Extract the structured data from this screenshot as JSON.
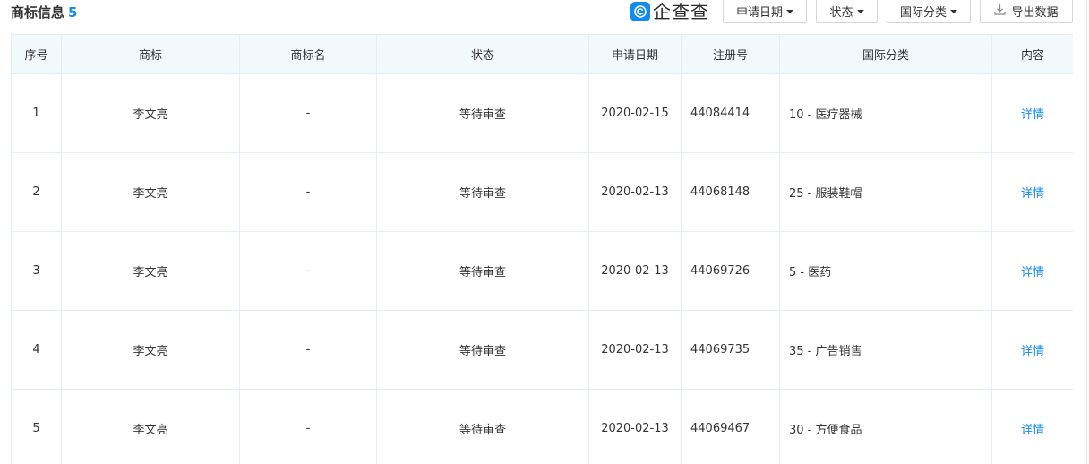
{
  "header": {
    "title": "商标信息",
    "count": "5",
    "brand_name": "企查查",
    "brand_icon": "qichacha-logo-icon",
    "filters": [
      {
        "label": "申请日期"
      },
      {
        "label": "状态"
      },
      {
        "label": "国际分类"
      }
    ],
    "export_label": "导出数据",
    "export_icon": "download-icon"
  },
  "colors": {
    "accent": "#128bed",
    "header_bg": "#f2f9fc",
    "border": "#e4eef6"
  },
  "table": {
    "columns": [
      "序号",
      "商标",
      "商标名",
      "状态",
      "申请日期",
      "注册号",
      "国际分类",
      "内容"
    ],
    "rows": [
      {
        "index": "1",
        "mark": "李文亮",
        "name": "-",
        "status": "等待审查",
        "date": "2020-02-15",
        "reg_no": "44084414",
        "class": "10 - 医疗器械",
        "action": "详情"
      },
      {
        "index": "2",
        "mark": "李文亮",
        "name": "-",
        "status": "等待审查",
        "date": "2020-02-13",
        "reg_no": "44068148",
        "class": "25 - 服装鞋帽",
        "action": "详情"
      },
      {
        "index": "3",
        "mark": "李文亮",
        "name": "-",
        "status": "等待审查",
        "date": "2020-02-13",
        "reg_no": "44069726",
        "class": "5 - 医药",
        "action": "详情"
      },
      {
        "index": "4",
        "mark": "李文亮",
        "name": "-",
        "status": "等待审查",
        "date": "2020-02-13",
        "reg_no": "44069735",
        "class": "35 - 广告销售",
        "action": "详情"
      },
      {
        "index": "5",
        "mark": "李文亮",
        "name": "-",
        "status": "等待审查",
        "date": "2020-02-13",
        "reg_no": "44069467",
        "class": "30 - 方便食品",
        "action": "详情"
      }
    ]
  }
}
